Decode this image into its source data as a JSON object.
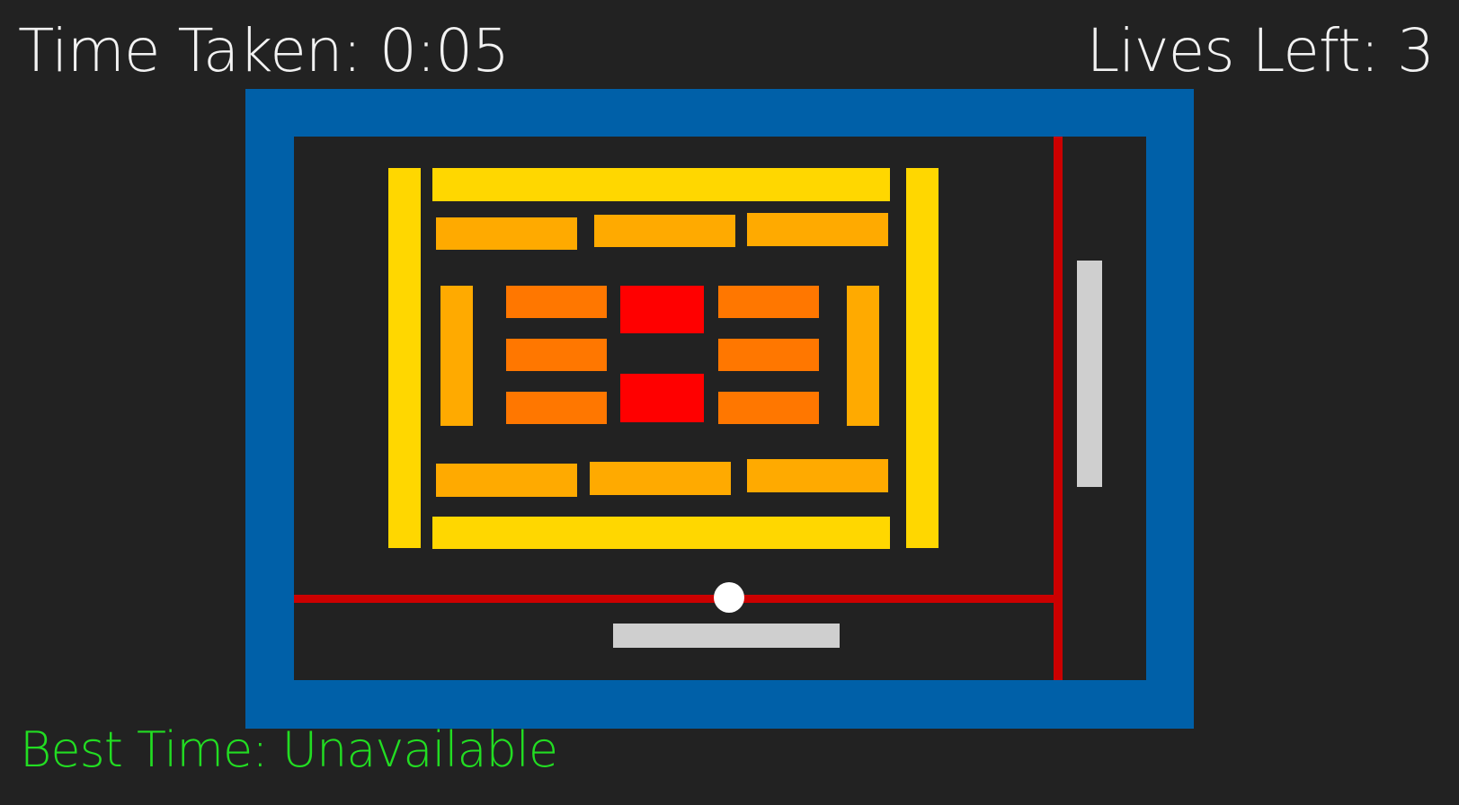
{
  "hud": {
    "time_label": "Time Taken: 0:05",
    "lives_label": "Lives Left: 3",
    "best_time_label": "Best Time: Unavailable"
  },
  "game": {
    "lives": 3,
    "elapsed_time": "0:05",
    "best_time": "Unavailable"
  },
  "colors": {
    "background": "#222222",
    "frame": "#0060a8",
    "arena": "#222222",
    "boundary_line": "#cc0000",
    "brick_yellow": "#ffd700",
    "brick_amber": "#ffaa00",
    "brick_orange": "#ff7700",
    "brick_red": "#ff0000",
    "paddle": "#cfcfcf",
    "ball": "#ffffff",
    "hud_text": "#f2f2f2",
    "best_time_text": "#22dd22"
  }
}
